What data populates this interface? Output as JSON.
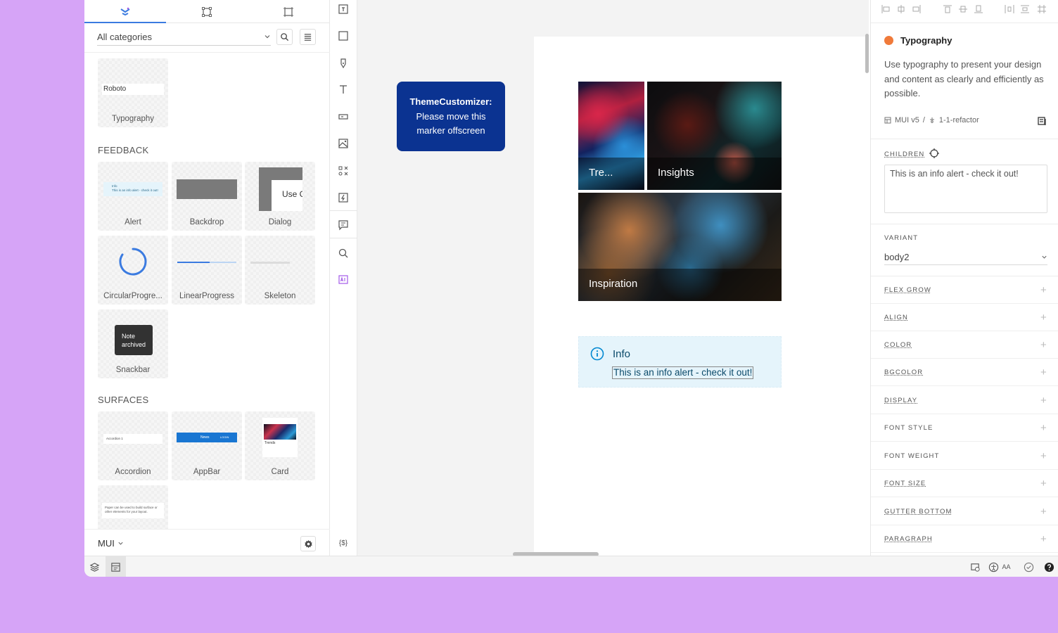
{
  "left_panel": {
    "category_select": "All categories",
    "typography_tile": {
      "preview_text": "Roboto",
      "label": "Typography"
    },
    "sections": [
      {
        "title": "FEEDBACK",
        "items": [
          "Alert",
          "Backdrop",
          "Dialog",
          "CircularProgre...",
          "LinearProgress",
          "Skeleton",
          "Snackbar"
        ]
      },
      {
        "title": "SURFACES",
        "items": [
          "Accordion",
          "AppBar",
          "Card"
        ]
      }
    ],
    "previews": {
      "alert_title": "Info",
      "alert_msg": "This is an info alert - check it out!",
      "dialog_text": "Use G",
      "snackbar_line1": "Note",
      "snackbar_line2": "archived",
      "accordion_text": "Accordion 1",
      "appbar_text": "News",
      "appbar_login": "LOGIN",
      "card_title": "Trends",
      "paper_text": "Paper can be used to build surface or other elements for your layout."
    },
    "footer_select": "MUI"
  },
  "canvas": {
    "marker_title": "ThemeCustomizer:",
    "marker_line1": "Please move this",
    "marker_line2": "marker offscreen",
    "image_labels": [
      "Tre...",
      "Insights",
      "Inspiration"
    ],
    "alert_title": "Info",
    "alert_message": "This is an info alert - check it out!"
  },
  "right_panel": {
    "component_title": "Typography",
    "description": "Use typography to present your design and content as clearly and efficiently as possible.",
    "library": "MUI v5",
    "branch": "1-1-refactor",
    "children_label": "CHILDREN",
    "children_value": "This is an info alert - check it out!",
    "variant_label": "VARIANT",
    "variant_value": "body2",
    "properties": [
      "FLEX GROW",
      "ALIGN",
      "COLOR",
      "BGCOLOR",
      "DISPLAY",
      "FONT STYLE",
      "FONT WEIGHT",
      "FONT SIZE",
      "GUTTER BOTTOM",
      "PARAGRAPH"
    ]
  },
  "bottom_bar": {
    "aa_label": "AA"
  },
  "toolbar": {
    "code_label": "{$}"
  },
  "colors": {
    "accent": "#3b7be0",
    "marker_bg": "#0b3391",
    "alert_bg": "#e5f4fb",
    "title_icon": "#f07a3a",
    "background": "#d6a4f7"
  },
  "icons": [
    "logo-icon",
    "frame-icon",
    "component-icon",
    "search-icon",
    "list-icon",
    "gear-icon",
    "layers-icon",
    "info-icon",
    "help-icon"
  ]
}
